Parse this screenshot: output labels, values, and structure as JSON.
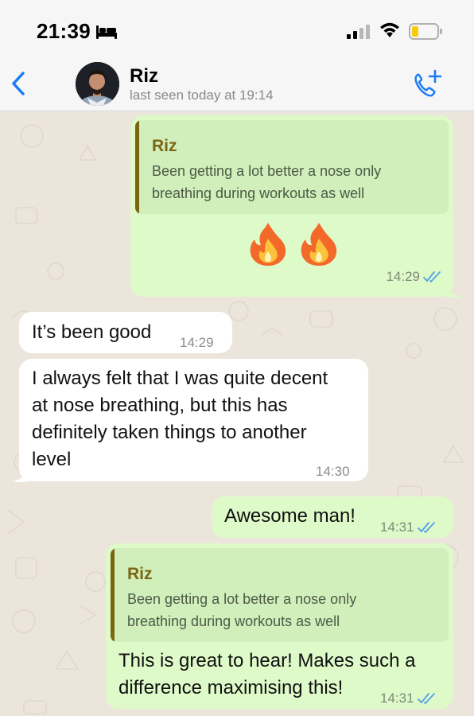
{
  "status_bar": {
    "time": "21:39",
    "icons": [
      "bed-icon",
      "signal-icon",
      "wifi-icon",
      "battery-icon"
    ]
  },
  "header": {
    "back_icon": "chevron-left-icon",
    "contact_name": "Riz",
    "last_seen": "last seen today at 19:14",
    "call_icon": "add-call-icon"
  },
  "colors": {
    "accent": "#1a7cf5",
    "outgoing_bubble": "#defac9",
    "incoming_bubble": "#ffffff",
    "quote_bar": "#7b6510",
    "read_ticks": "#4fa3e8"
  },
  "messages": [
    {
      "direction": "out",
      "quote": {
        "author": "Riz",
        "text": "Been getting a lot better a nose only breathing during workouts as well"
      },
      "body": "🔥 🔥",
      "time": "14:29",
      "status": "read"
    },
    {
      "direction": "in",
      "body": "It’s been good",
      "time": "14:29"
    },
    {
      "direction": "in",
      "body_lines": [
        "I always felt that I was quite decent",
        "at nose breathing, but this has",
        "definitely taken things to another",
        "level"
      ],
      "time": "14:30"
    },
    {
      "direction": "out",
      "body": "Awesome man!",
      "time": "14:31",
      "status": "read"
    },
    {
      "direction": "out",
      "quote": {
        "author": "Riz",
        "text": "Been getting a lot better a nose only breathing during workouts as well"
      },
      "body_lines": [
        "This is great to hear! Makes such a",
        "difference maximising this!"
      ],
      "time": "14:31",
      "status": "read"
    }
  ]
}
